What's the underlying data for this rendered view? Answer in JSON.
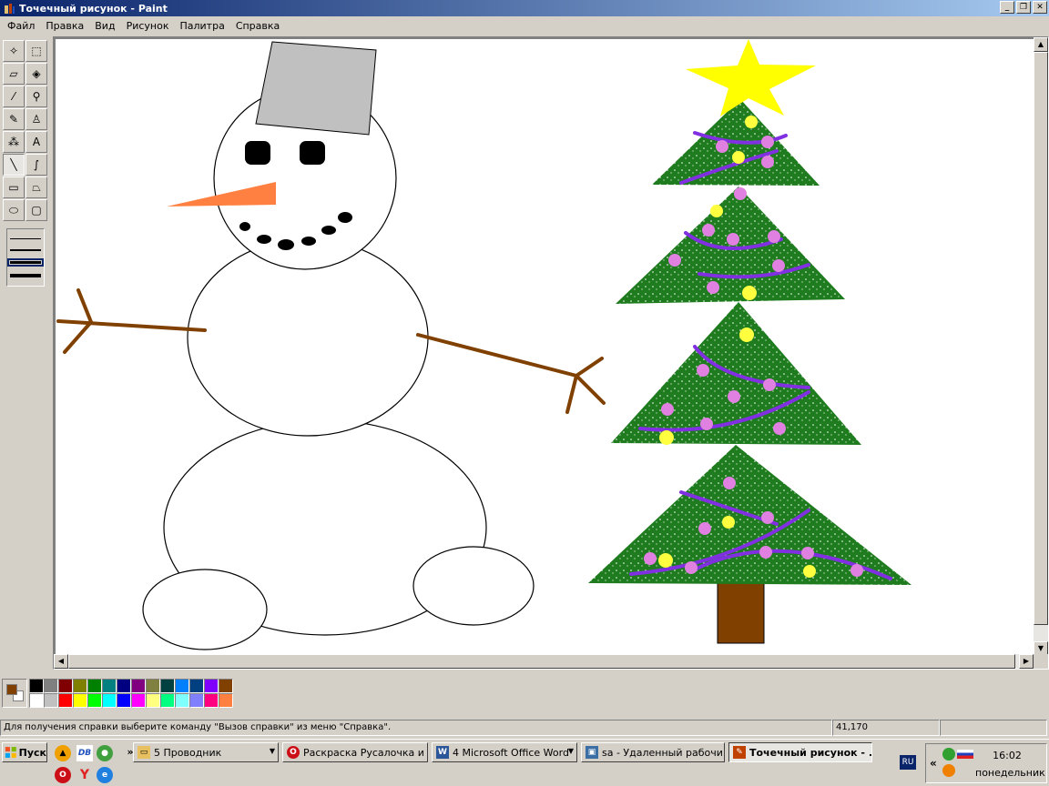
{
  "window": {
    "title": "Точечный рисунок - Paint"
  },
  "menu": [
    "Файл",
    "Правка",
    "Вид",
    "Рисунок",
    "Палитра",
    "Справка"
  ],
  "tools": [
    {
      "name": "free-select-tool",
      "glyph": "✧"
    },
    {
      "name": "rect-select-tool",
      "glyph": "⬚"
    },
    {
      "name": "eraser-tool",
      "glyph": "▱"
    },
    {
      "name": "fill-tool",
      "glyph": "◈"
    },
    {
      "name": "color-picker-tool",
      "glyph": "⁄"
    },
    {
      "name": "magnifier-tool",
      "glyph": "⚲"
    },
    {
      "name": "pencil-tool",
      "glyph": "✎"
    },
    {
      "name": "brush-tool",
      "glyph": "♙"
    },
    {
      "name": "airbrush-tool",
      "glyph": "⁂"
    },
    {
      "name": "text-tool",
      "glyph": "A"
    },
    {
      "name": "line-tool",
      "glyph": "╲"
    },
    {
      "name": "curve-tool",
      "glyph": "∫"
    },
    {
      "name": "rectangle-tool",
      "glyph": "▭"
    },
    {
      "name": "polygon-tool",
      "glyph": "⏢"
    },
    {
      "name": "ellipse-tool",
      "glyph": "⬭"
    },
    {
      "name": "rounded-rect-tool",
      "glyph": "▢"
    }
  ],
  "active_tool": "line-tool",
  "colors": {
    "foreground": "#804000",
    "background": "#ffffff",
    "palette": [
      "#000000",
      "#808080",
      "#800000",
      "#808000",
      "#008000",
      "#008080",
      "#000080",
      "#800080",
      "#808040",
      "#004040",
      "#0080ff",
      "#004080",
      "#8000ff",
      "#804000",
      "#ffffff",
      "#c0c0c0",
      "#ff0000",
      "#ffff00",
      "#00ff00",
      "#00ffff",
      "#0000ff",
      "#ff00ff",
      "#ffff80",
      "#00ff80",
      "#80ffff",
      "#8080ff",
      "#ff0080",
      "#ff8040"
    ]
  },
  "status": {
    "help": "Для получения справки выберите команду \"Вызов справки\" из меню \"Справка\".",
    "coords": "41,170"
  },
  "taskbar": {
    "start": "Пуск",
    "overflow": "»",
    "buttons": [
      {
        "label": "5 Проводник",
        "icon": "folder-icon",
        "color": "#e8c060"
      },
      {
        "label": "Раскраска Русалочка и ...",
        "icon": "opera-icon",
        "color": "#cc0f16"
      },
      {
        "label": "4 Microsoft Office Word",
        "icon": "word-icon",
        "color": "#2b579a"
      },
      {
        "label": "sa - Удаленный рабочи...",
        "icon": "remote-desktop-icon",
        "color": "#3a6ea5"
      },
      {
        "label": "Точечный рисунок - ...",
        "icon": "paint-icon",
        "color": "#c04000"
      }
    ],
    "lang": "RU",
    "tray_expand": "«",
    "clock_time": "16:02",
    "clock_day": "понедельник"
  }
}
